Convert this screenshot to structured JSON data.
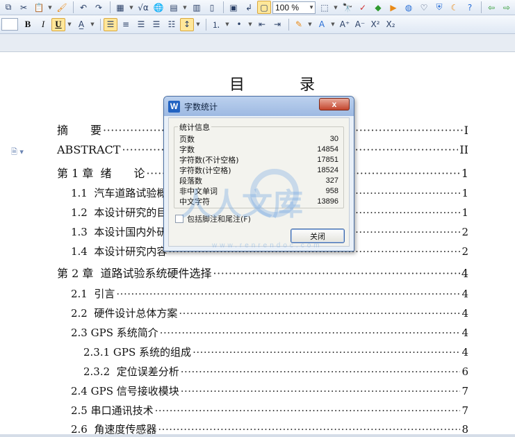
{
  "toolbar": {
    "zoom": "100 %"
  },
  "format_toolbar": {
    "bold": "B",
    "italic": "I",
    "underline": "U",
    "font_color_label": "A",
    "superscript": "X²",
    "subscript": "X₂"
  },
  "document": {
    "toc_title": "目 录",
    "entries": [
      {
        "label": "摘　　要",
        "page": "I"
      },
      {
        "label": "ABSTRACT",
        "page": "II"
      },
      {
        "label": "第 1 章  绪　　论",
        "page": "1"
      },
      {
        "label": "1.1  汽车道路试验概",
        "page": "1"
      },
      {
        "label": "1.2  本设计研究的目",
        "page": "1"
      },
      {
        "label": "1.3  本设计国内外研",
        "page": "2"
      },
      {
        "label": "1.4  本设计研究内容",
        "page": "2"
      },
      {
        "label": "第 2 章  道路试验系统硬件选择",
        "page": "4"
      },
      {
        "label": "2.1  引言",
        "page": "4"
      },
      {
        "label": "2.2  硬件设计总体方案",
        "page": "4"
      },
      {
        "label": "2.3 GPS 系统简介",
        "page": "4"
      },
      {
        "label": "2.3.1 GPS 系统的组成",
        "page": "4"
      },
      {
        "label": "2.3.2  定位误差分析",
        "page": "6"
      },
      {
        "label": "2.4 GPS 信号接收模块",
        "page": "7"
      },
      {
        "label": "2.5 串口通讯技术",
        "page": "7"
      },
      {
        "label": "2.6  角速度传感器",
        "page": "8"
      }
    ]
  },
  "dialog": {
    "logo": "W",
    "title": "字数统计",
    "close_x": "x",
    "group_title": "统计信息",
    "stats": [
      {
        "label": "页数",
        "value": "30"
      },
      {
        "label": "字数",
        "value": "14854"
      },
      {
        "label": "字符数(不计空格)",
        "value": "17851"
      },
      {
        "label": "字符数(计空格)",
        "value": "18524"
      },
      {
        "label": "段落数",
        "value": "327"
      },
      {
        "label": "非中文单词",
        "value": "958"
      },
      {
        "label": "中文字符",
        "value": "13896"
      }
    ],
    "checkbox_label": "包括脚注和尾注(F)",
    "close_button": "关闭"
  },
  "watermark": {
    "text": "人人文库",
    "url": "www.renrendoc.com"
  }
}
